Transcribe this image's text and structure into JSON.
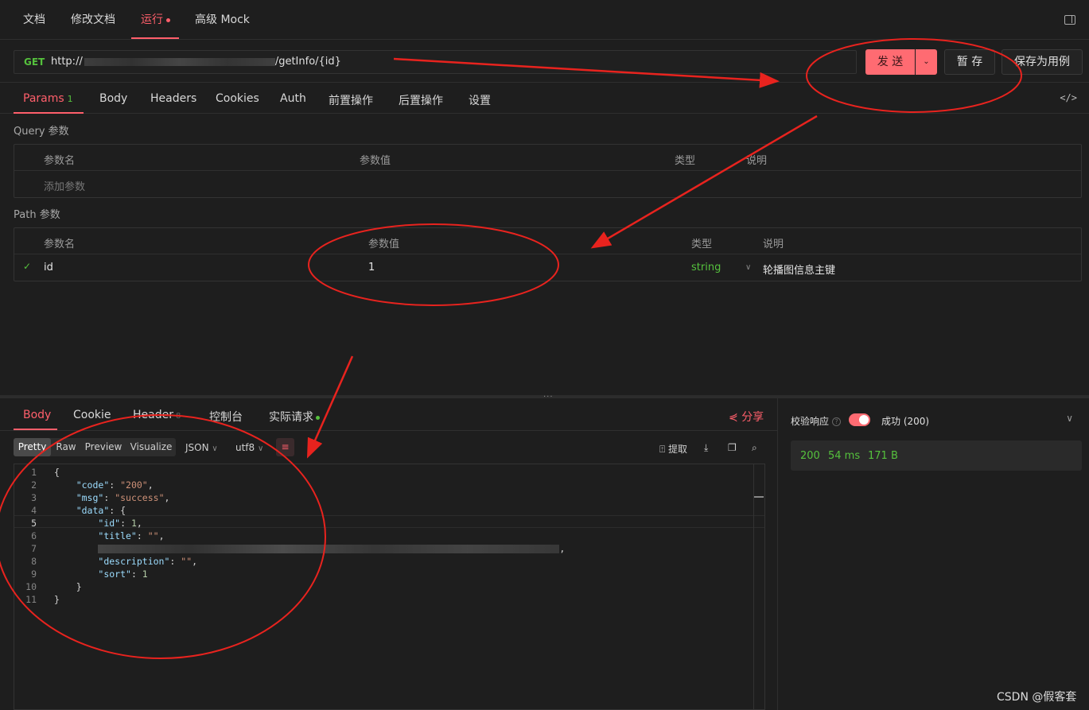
{
  "top_tabs": [
    {
      "label": "文档"
    },
    {
      "label": "修改文档"
    },
    {
      "label": "运行"
    },
    {
      "label": "高级 Mock"
    }
  ],
  "url_bar": {
    "method": "GET",
    "url_prefix": "http://",
    "url_suffix": "/getInfo/{id}"
  },
  "buttons": {
    "send": "发 送",
    "stash": "暂 存",
    "save_as_case": "保存为用例"
  },
  "request_tabs": [
    {
      "label": "Params",
      "count": "1"
    },
    {
      "label": "Body"
    },
    {
      "label": "Headers"
    },
    {
      "label": "Cookies"
    },
    {
      "label": "Auth"
    },
    {
      "label": "前置操作"
    },
    {
      "label": "后置操作"
    },
    {
      "label": "设置"
    }
  ],
  "query": {
    "title": "Query 参数",
    "headers": [
      "参数名",
      "参数值",
      "类型",
      "说明"
    ],
    "add_placeholder": "添加参数"
  },
  "path": {
    "title": "Path 参数",
    "headers": [
      "参数名",
      "参数值",
      "类型",
      "说明"
    ],
    "row": {
      "name": "id",
      "value": "1",
      "type": "string",
      "description": "轮播图信息主键"
    }
  },
  "response_tabs": [
    {
      "label": "Body"
    },
    {
      "label": "Cookie"
    },
    {
      "label": "Header",
      "count": "8"
    },
    {
      "label": "控制台"
    },
    {
      "label": "实际请求"
    }
  ],
  "share_label": "分享",
  "view_modes": [
    "Pretty",
    "Raw",
    "Preview",
    "Visualize"
  ],
  "format": "JSON",
  "encoding": "utf8",
  "extract_label": "提取",
  "code_lines": {
    "l1": "{",
    "code_key": "\"code\"",
    "code_val": "\"200\"",
    "msg_key": "\"msg\"",
    "msg_val": "\"success\"",
    "data_key": "\"data\"",
    "id_key": "\"id\"",
    "id_val": "1",
    "title_key": "\"title\"",
    "title_val": "\"\"",
    "desc_key": "\"description\"",
    "desc_val": "\"\"",
    "sort_key": "\"sort\"",
    "sort_val": "1",
    "close_inner": "}",
    "close_outer": "}"
  },
  "line_numbers": [
    "1",
    "2",
    "3",
    "4",
    "5",
    "6",
    "7",
    "8",
    "9",
    "10",
    "11"
  ],
  "side": {
    "validate_label": "校验响应",
    "status_text": "成功 (200)",
    "status_code": "200",
    "time": "54 ms",
    "size": "171 B"
  },
  "watermark": "CSDN @假客套",
  "colors": {
    "accent": "#ff5f6b",
    "green": "#55c13d",
    "annotation": "#e8231e"
  }
}
